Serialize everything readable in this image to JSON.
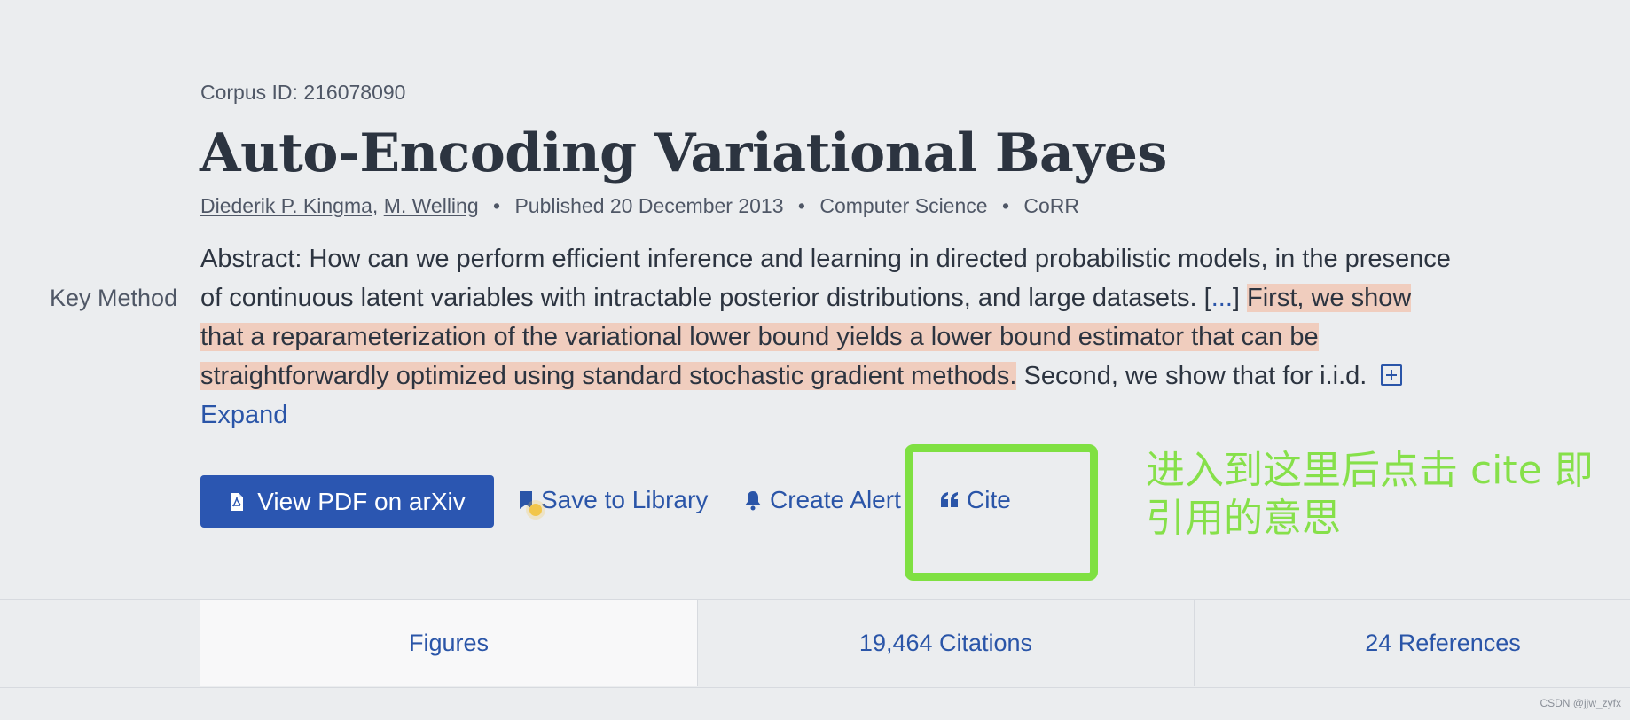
{
  "paper": {
    "corpus_id": "Corpus ID: 216078090",
    "title": "Auto-Encoding Variational Bayes",
    "authors": [
      "Diederik P. Kingma",
      "M. Welling"
    ],
    "published": "Published 20 December 2013",
    "field": "Computer Science",
    "venue": "CoRR",
    "separator": "•"
  },
  "abstract": {
    "key_method_label": "Key Method",
    "text_lead": "Abstract: How can we perform efficient inference and learning in directed probabilistic models, in the presence of continuous latent variables with intractable posterior distributions, and large datasets. [",
    "ellipsis": "...",
    "text_close": "]",
    "highlighted": "First, we show that a reparameterization of the variational lower bound yields a lower bound estimator that can be straightforwardly optimized using standard stochastic gradient methods.",
    "text_tail": " Second, we show that for i.i.d.",
    "expand_label": "Expand"
  },
  "actions": {
    "view_pdf": "View PDF on arXiv",
    "save": "Save to Library",
    "alert": "Create Alert",
    "cite": "Cite"
  },
  "annotation": {
    "text": "进入到这里后点击 cite 即引用的意思",
    "color": "#86e04a",
    "box_color": "#7fe042"
  },
  "tabs": [
    {
      "label": "Figures",
      "active": true
    },
    {
      "label": "19,464 Citations",
      "active": false
    },
    {
      "label": "24 References",
      "active": false
    }
  ],
  "watermark": "CSDN @jjw_zyfx",
  "colors": {
    "accent": "#2a55a8",
    "button_bg": "#2b56b1",
    "highlight": "#f0cdbe",
    "background": "#ebedef"
  }
}
